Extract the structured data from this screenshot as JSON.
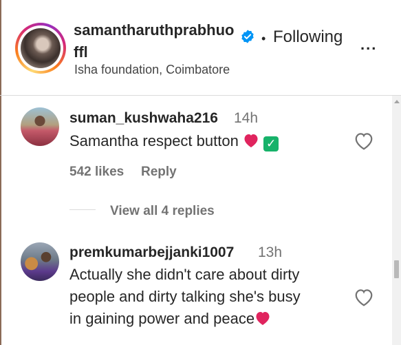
{
  "post_header": {
    "username": "samantharuthprabhuoffl",
    "verified_icon": "verified-badge-icon",
    "separator": "•",
    "follow_status": "Following",
    "more_options": "...",
    "location": "Isha foundation, Coimbatore"
  },
  "comments": [
    {
      "username": "suman_kushwaha216",
      "time": "14h",
      "text": "Samantha respect button",
      "emojis": [
        "red-heart-emoji",
        "check-mark-button-emoji"
      ],
      "likes": "542 likes",
      "reply_label": "Reply",
      "view_replies": "View all 4 replies"
    },
    {
      "username": "premkumarbejjanki1007",
      "time": "13h",
      "text_lines": [
        "Actually she didn't care about dirty",
        "people and dirty talking she's busy",
        "in gaining power and peace"
      ],
      "emojis": [
        "red-heart-emoji"
      ]
    }
  ],
  "colors": {
    "text_primary": "#262626",
    "text_secondary": "#737373",
    "verified_blue": "#0095f6",
    "heart_red": "#e0245e",
    "check_green": "#17b26a",
    "divider": "#dbdbdb"
  }
}
